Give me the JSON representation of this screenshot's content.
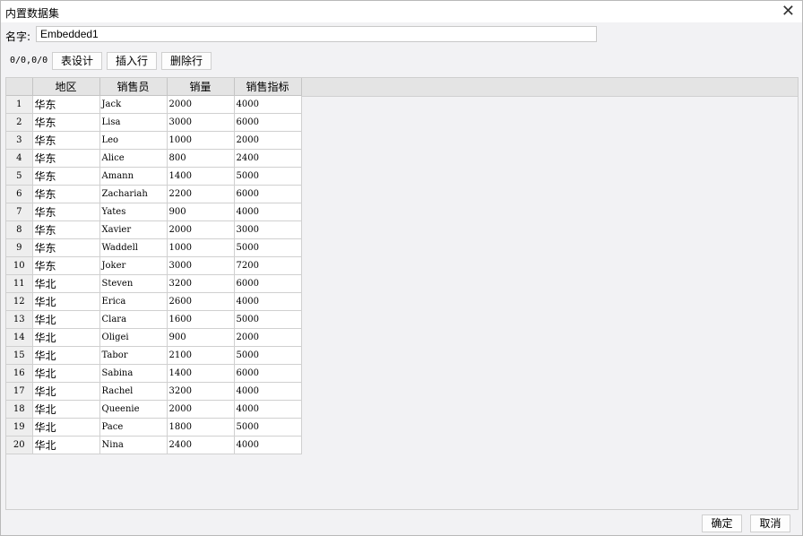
{
  "window": {
    "title": "内置数据集",
    "close_glyph": "✕"
  },
  "name": {
    "label": "名字:",
    "value": "Embedded1"
  },
  "toolbar": {
    "position": "0/0,0/0",
    "table_design": "表设计",
    "insert_row": "插入行",
    "delete_row": "删除行"
  },
  "columns": [
    "地区",
    "销售员",
    "销量",
    "销售指标"
  ],
  "rows": [
    [
      "华东",
      "Jack",
      "2000",
      "4000"
    ],
    [
      "华东",
      "Lisa",
      "3000",
      "6000"
    ],
    [
      "华东",
      "Leo",
      "1000",
      "2000"
    ],
    [
      "华东",
      "Alice",
      "800",
      "2400"
    ],
    [
      "华东",
      "Amann",
      "1400",
      "5000"
    ],
    [
      "华东",
      "Zachariah",
      "2200",
      "6000"
    ],
    [
      "华东",
      "Yates",
      "900",
      "4000"
    ],
    [
      "华东",
      "Xavier",
      "2000",
      "3000"
    ],
    [
      "华东",
      "Waddell",
      "1000",
      "5000"
    ],
    [
      "华东",
      "Joker",
      "3000",
      "7200"
    ],
    [
      "华北",
      "Steven",
      "3200",
      "6000"
    ],
    [
      "华北",
      "Erica",
      "2600",
      "4000"
    ],
    [
      "华北",
      "Clara",
      "1600",
      "5000"
    ],
    [
      "华北",
      "Oligei",
      "900",
      "2000"
    ],
    [
      "华北",
      "Tabor",
      "2100",
      "5000"
    ],
    [
      "华北",
      "Sabina",
      "1400",
      "6000"
    ],
    [
      "华北",
      "Rachel",
      "3200",
      "4000"
    ],
    [
      "华北",
      "Queenie",
      "2000",
      "4000"
    ],
    [
      "华北",
      "Pace",
      "1800",
      "5000"
    ],
    [
      "华北",
      "Nina",
      "2400",
      "4000"
    ]
  ],
  "footer": {
    "ok": "确定",
    "cancel": "取消"
  }
}
